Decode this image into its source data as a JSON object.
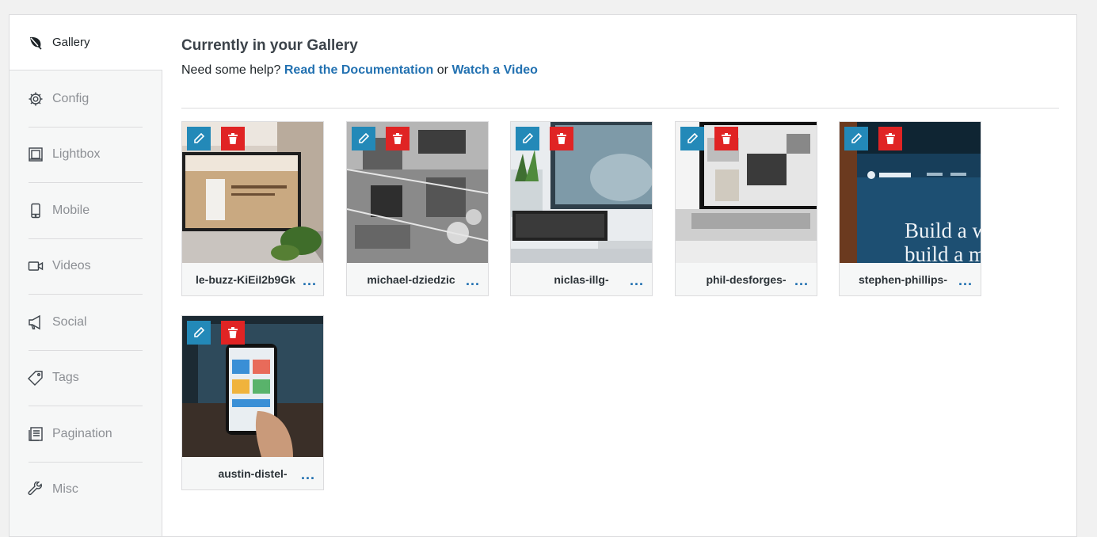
{
  "sidebar": {
    "items": [
      {
        "label": "Gallery",
        "icon": "leaf-icon",
        "active": true
      },
      {
        "label": "Config",
        "icon": "gear-icon"
      },
      {
        "label": "Lightbox",
        "icon": "lightbox-icon"
      },
      {
        "label": "Mobile",
        "icon": "mobile-icon"
      },
      {
        "label": "Videos",
        "icon": "video-camera-icon"
      },
      {
        "label": "Social",
        "icon": "megaphone-icon"
      },
      {
        "label": "Tags",
        "icon": "tag-icon"
      },
      {
        "label": "Pagination",
        "icon": "pagination-icon"
      },
      {
        "label": "Misc",
        "icon": "wrench-icon"
      }
    ]
  },
  "main": {
    "title": "Currently in your Gallery",
    "help_prefix": "Need some help? ",
    "doc_link": "Read the Documentation",
    "help_or": " or ",
    "video_link": "Watch a Video"
  },
  "gallery": {
    "items": [
      {
        "caption": "le-buzz-KiEiI2b9Gk",
        "more": "..."
      },
      {
        "caption": "michael-dziedzic",
        "more": "..."
      },
      {
        "caption": "niclas-illg-",
        "more": "..."
      },
      {
        "caption": "phil-desforges-",
        "more": "..."
      },
      {
        "caption": "stephen-phillips-",
        "more": "..."
      },
      {
        "caption": "austin-distel-",
        "more": "..."
      }
    ]
  },
  "colors": {
    "edit": "#2389b8",
    "delete": "#e02424",
    "link": "#2271b1"
  }
}
